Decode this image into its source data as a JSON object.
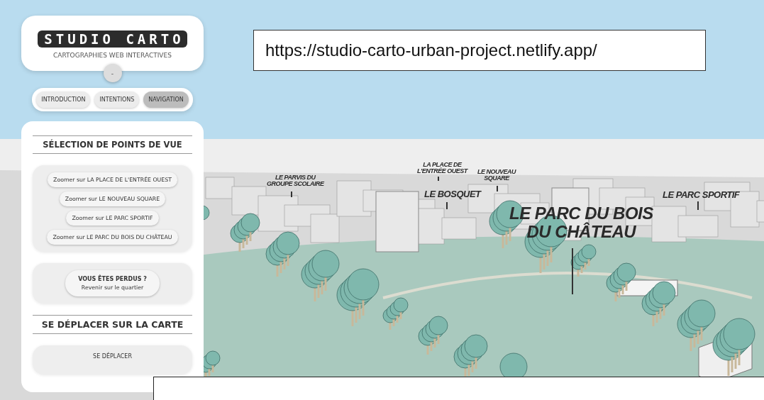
{
  "header": {
    "logo": "STUDIO CARTO",
    "subtitle": "CARTOGRAPHIES WEB INTERACTIVES",
    "toggle": "-"
  },
  "tabs": [
    {
      "label": "INTRODUCTION",
      "selected": false
    },
    {
      "label": "INTENTIONS",
      "selected": false
    },
    {
      "label": "NAVIGATION",
      "selected": true
    }
  ],
  "viewpoints": {
    "title": "SÉLECTION DE POINTS DE VUE",
    "buttons": [
      "Zoomer sur LA PLACE DE L'ENTRÉE OUEST",
      "Zoomer sur LE NOUVEAU SQUARE",
      "Zoomer sur LE PARC SPORTIF",
      "Zoomer sur LE PARC DU BOIS DU CHÂTEAU"
    ],
    "lost_button": [
      "VOUS ÊTES PERDUS ?",
      "Revenir sur le quartier"
    ]
  },
  "move": {
    "title": "SE DÉPLACER SUR LA CARTE",
    "buttons": [
      "SE DÉPLACER"
    ]
  },
  "map_labels": [
    {
      "kind": "minor",
      "lines": [
        "LE PARVIS DU",
        "GROUPE SCOLAIRE"
      ]
    },
    {
      "kind": "minor",
      "lines": [
        "LA PLACE DE",
        "L'ENTRÉE OUEST"
      ]
    },
    {
      "kind": "minor",
      "lines": [
        "LE NOUVEAU",
        "SQUARE"
      ]
    },
    {
      "kind": "medium",
      "lines": [
        "LE BOSQUET"
      ]
    },
    {
      "kind": "major",
      "lines": [
        "LE PARC DU BOIS",
        "DU CHÂTEAU"
      ]
    },
    {
      "kind": "medium",
      "lines": [
        "LE PARC SPORTIF"
      ]
    }
  ],
  "url_banner": {
    "text": "https://studio-carto-urban-project.netlify.app/"
  }
}
